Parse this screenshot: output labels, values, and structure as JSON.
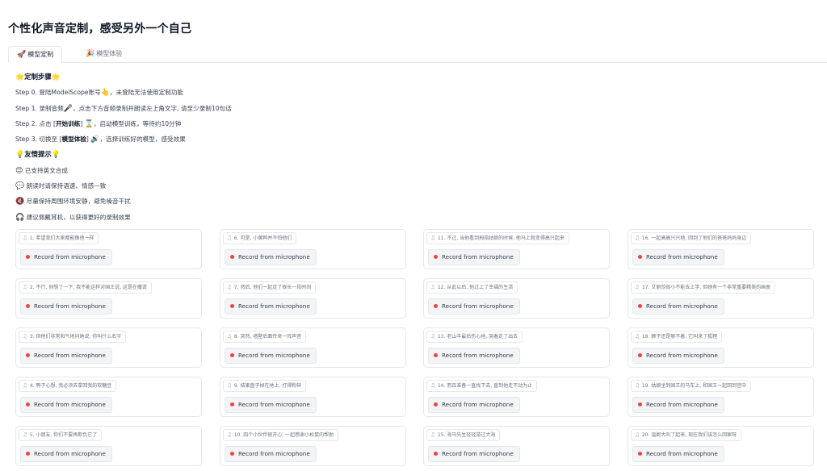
{
  "page": {
    "title": "个性化声音定制，感受另外一个自己"
  },
  "tabs": [
    {
      "label": "模型定制",
      "icon": "rocket-icon",
      "active": true
    },
    {
      "label": "模型体验",
      "icon": "party-icon",
      "active": false
    }
  ],
  "steps": {
    "heading": "定制步骤",
    "s0_a": "Step 0. 登陆ModelScope账号",
    "s0_b": "，未登陆无法使用定制功能",
    "s1_a": "Step 1. 录制音频",
    "s1_b": "，点击下方音频录制并朗读左上角文字, 请至少录制10句话",
    "s2_a": "Step 2. 点击 [",
    "s2_bold": "开始训练",
    "s2_b": "] ",
    "s2_c": "，启动模型训练，等待约10分钟",
    "s3_a": "Step 3. 切换至 [",
    "s3_bold": "模型体验",
    "s3_b": "] ",
    "s3_c": "，选择训练好的模型，感受效果"
  },
  "tips": {
    "heading": "友情提示",
    "t1": "已支持英文合成",
    "t2": "朗读时请保持语速、情感一致",
    "t3": "尽量保持周围环境安静，避免噪音干扰",
    "t4": "建议佩戴耳机，以获得更好的录制效果"
  },
  "record_button_label": "Record from microphone",
  "recordings": [
    "1. 希望我们大家都能像他一样",
    "2. 不行, 他想了一下, 我不能这样对国王说, 这是在撒谎",
    "3. 但他们非常和气地问她说, 你叫什么名字",
    "4. 鸭子心想, 我必须去拿回我的软糖豆",
    "5. 小朋友, 你们不要再欺负它了",
    "6. 可是, 小黄鸭并不怕他们",
    "7. 然后, 他们一起走了很长一段时间",
    "8. 突然, 墙壁后面传来一阵声音",
    "9. 结果盘子掉在地上, 打得粉碎",
    "10. 四个小伙伴很开心, 一起感谢小松鼠的帮助",
    "11. 不过, 当他看到拇指姑娘的时候, 他马上就变得高兴起来",
    "12. 从此以后, 他过上了幸福的生活",
    "13. 老山羊最后伤心地, 哭着走了出去",
    "14. 而且准备一直找下去, 直到他走不动为止",
    "15. 海马先生轻轻游过大海",
    "16. 一起高高兴兴地, 回到了他们的爸爸妈妈身边",
    "17. 艾丽莎很小不能去上学, 但她有一个非常重要精美的画册",
    "18. 狮子还是够不着, 它叫来了狐狸",
    "19. 姑娘坐到国王的马车上, 和国王一起回到宫中",
    "20. 温妮大叫了起来, 现在我们该怎么回家呀"
  ]
}
